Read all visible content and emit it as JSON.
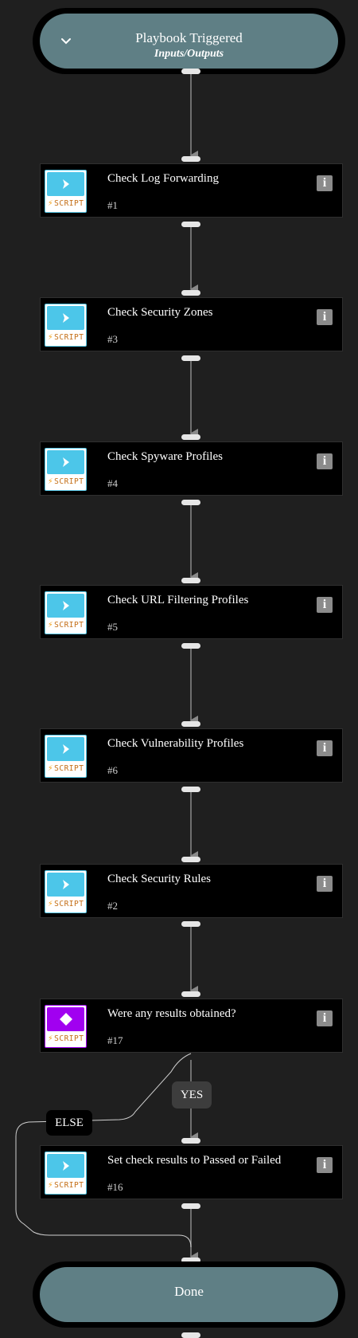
{
  "start": {
    "title": "Playbook Triggered",
    "subtitle": "Inputs/Outputs",
    "icon": "chevron-down-icon"
  },
  "tasks": [
    {
      "name": "Check Log Forwarding",
      "id": "#1",
      "type_label": "SCRIPT",
      "icon": "script-icon"
    },
    {
      "name": "Check Security Zones",
      "id": "#3",
      "type_label": "SCRIPT",
      "icon": "script-icon"
    },
    {
      "name": "Check Spyware Profiles",
      "id": "#4",
      "type_label": "SCRIPT",
      "icon": "script-icon"
    },
    {
      "name": "Check URL Filtering Profiles",
      "id": "#5",
      "type_label": "SCRIPT",
      "icon": "script-icon"
    },
    {
      "name": "Check Vulnerability Profiles",
      "id": "#6",
      "type_label": "SCRIPT",
      "icon": "script-icon"
    },
    {
      "name": "Check Security Rules",
      "id": "#2",
      "type_label": "SCRIPT",
      "icon": "script-icon"
    },
    {
      "name": "Were any results obtained?",
      "id": "#17",
      "type_label": "SCRIPT",
      "icon": "condition-icon"
    },
    {
      "name": "Set check results to Passed or Failed",
      "id": "#16",
      "type_label": "SCRIPT",
      "icon": "script-icon"
    }
  ],
  "branches": {
    "yes": "YES",
    "else": "ELSE"
  },
  "end": {
    "title": "Done"
  },
  "info_glyph": "i",
  "colors": {
    "background": "#1f1f1f",
    "pill": "#5f7f85",
    "script_accent": "#4cc6e9",
    "condition_accent": "#a100f0",
    "label_orange": "#c46e16"
  }
}
